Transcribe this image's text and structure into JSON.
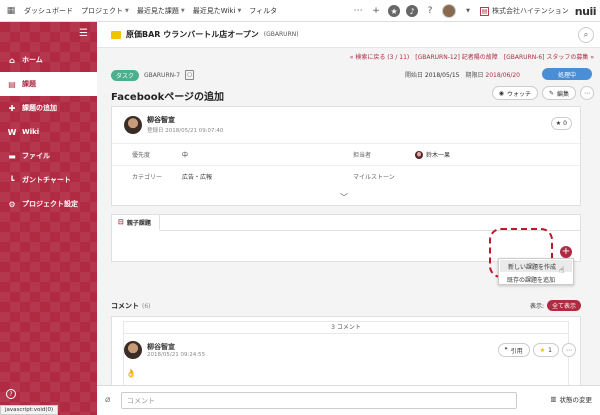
{
  "topbar": {
    "nav": [
      "ダッシュボード",
      "プロジェクト",
      "最近見た課題",
      "最近見たWiki",
      "フィルタ"
    ],
    "company": "株式会社ハイテンション",
    "logo": "nuii"
  },
  "sidebar": {
    "items": [
      {
        "label": "ホーム",
        "icon": "home-icon",
        "active": false
      },
      {
        "label": "課題",
        "icon": "list-icon",
        "active": true
      },
      {
        "label": "課題の追加",
        "icon": "plus-icon",
        "active": false
      },
      {
        "label": "Wiki",
        "icon": "wiki-icon",
        "active": false
      },
      {
        "label": "ファイル",
        "icon": "folder-icon",
        "active": false
      },
      {
        "label": "ガントチャート",
        "icon": "gantt-icon",
        "active": false
      },
      {
        "label": "プロジェクト設定",
        "icon": "gear-icon",
        "active": false
      }
    ]
  },
  "project": {
    "name": "原価BAR ウランバートル店オープン",
    "key": "(GBARURN)"
  },
  "breadcrumbs": {
    "back": "« 検索に戻る (3 / 11)",
    "prev": "[GBARURN-12] 記者陽の故障",
    "next": "[GBARURN-6] スタッフの募集 »"
  },
  "issue": {
    "tag": "タスク",
    "key": "GBARURN-7",
    "start_label": "開始日",
    "start": "2018/05/15",
    "due_label": "期限日",
    "due": "2018/06/20",
    "status": "処理中",
    "title": "Facebookページの追加",
    "watch": "ウォッチ",
    "edit": "編集",
    "star_count": "0",
    "author": "柳谷智宣",
    "created": "登録日 2018/05/21 09:07:40",
    "fields": [
      {
        "label": "優先度",
        "value": "中",
        "label2": "担当者",
        "value2": "鈴木一果"
      },
      {
        "label": "カテゴリー",
        "value": "広告・広報",
        "label2": "マイルストーン",
        "value2": ""
      }
    ]
  },
  "subtasks": {
    "tab": "親子課題",
    "menu": [
      "新しい課題を作成",
      "既存の課題を追加"
    ]
  },
  "comments": {
    "title": "コメント",
    "count": "(6)",
    "display_label": "表示:",
    "filter": "全て表示",
    "counter": "3 コメント",
    "author": "柳谷智宣",
    "date": "2018/05/21 09:24:55",
    "emoji": "👌",
    "quote": "引用",
    "star_count": "1"
  },
  "footer": {
    "placeholder": "コメント",
    "status_change": "状態の変更",
    "js_status": "javascript:void(0)"
  },
  "colors": {
    "brand": "#b02a42",
    "status_blue": "#4a8fd6",
    "task_green": "#4caf8e"
  }
}
